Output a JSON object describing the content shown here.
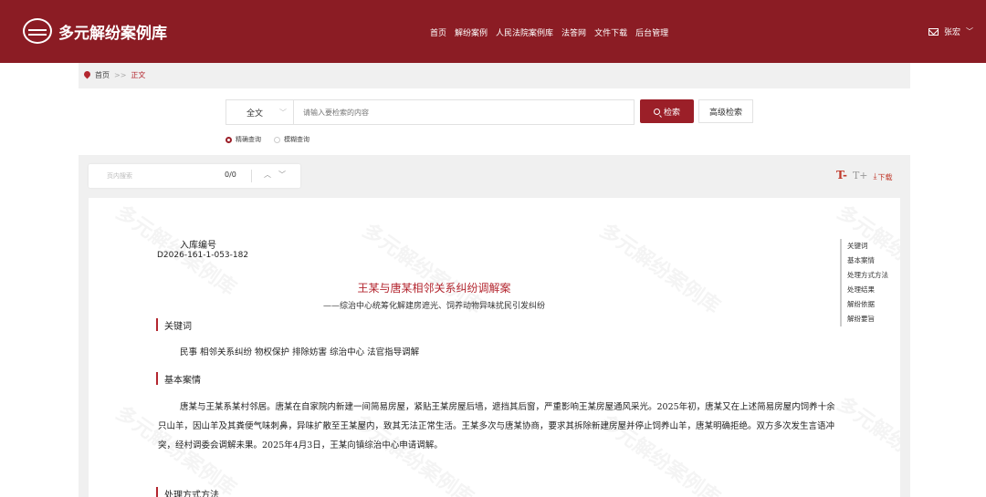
{
  "header": {
    "site_title": "多元解纷案例库",
    "nav": [
      "首页",
      "解纷案例",
      "人民法院案例库",
      "法答网",
      "文件下载",
      "后台管理"
    ],
    "user_name": "张宏"
  },
  "breadcrumb": {
    "home": "首页",
    "separator": ">>",
    "current": "正文"
  },
  "search": {
    "scope_value": "全文",
    "placeholder": "请输入要检索的内容",
    "search_button": "检索",
    "advanced_button": "高级检索",
    "mode_exact": "精确查询",
    "mode_fuzzy": "模糊查询"
  },
  "find": {
    "placeholder": "页内搜索",
    "count": "0/0"
  },
  "tools": {
    "font_decrease": "T-",
    "font_increase": "T+",
    "download": "下载"
  },
  "document": {
    "record_label": "入库编号",
    "record_number": "D2026-161-1-053-182",
    "title": "王某与唐某相邻关系纠纷调解案",
    "subtitle": "——综治中心统筹化解建房遮光、饲养动物异味扰民引发纠纷",
    "sections": {
      "keywords_heading": "关键词",
      "keywords": "民事 相邻关系纠纷 物权保护 排除妨害 综治中心 法官指导调解",
      "basic_heading": "基本案情",
      "basic_text": "唐某与王某系某村邻居。唐某在自家院内新建一间简易房屋，紧贴王某房屋后墙，遮挡其后窗，严重影响王某房屋通风采光。2025年初，唐某又在上述简易房屋内饲养十余只山羊，因山羊及其粪便气味刺鼻，异味扩散至王某屋内，致其无法正常生活。王某多次与唐某协商，要求其拆除新建房屋并停止饲养山羊，唐某明确拒绝。双方多次发生言语冲突，经村调委会调解未果。2025年4月3日，王某向镇综治中心申请调解。",
      "method_heading": "处理方式方法"
    },
    "watermark": "多元解纷案例库"
  },
  "toc": [
    "关键词",
    "基本案情",
    "处理方式方法",
    "处理结果",
    "解纷依据",
    "解纷要旨"
  ],
  "colors": {
    "brand": "#8b1c24",
    "accent": "#b3262f"
  }
}
